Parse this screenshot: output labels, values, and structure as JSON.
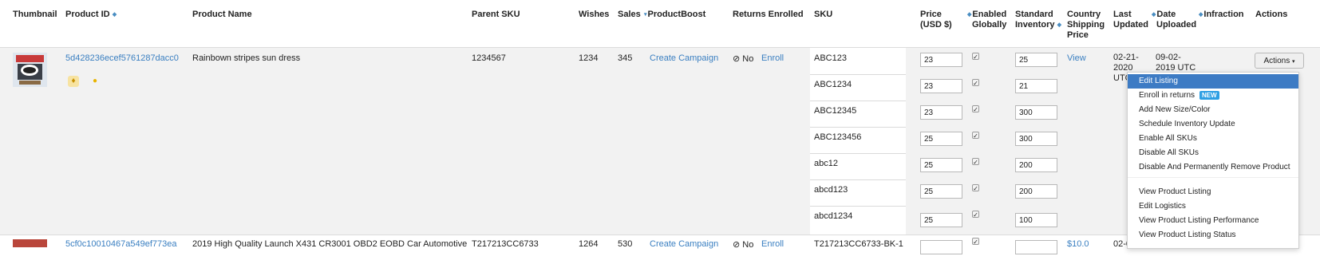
{
  "headers": {
    "thumbnail": "Thumbnail",
    "product_id": "Product ID",
    "product_name": "Product Name",
    "parent_sku": "Parent SKU",
    "wishes": "Wishes",
    "sales": "Sales",
    "product_boost": "ProductBoost",
    "returns_enrolled": "Returns Enrolled",
    "sku": "SKU",
    "price_l1": "Price",
    "price_l2": "(USD $)",
    "enabled_l1": "Enabled",
    "enabled_l2": "Globally",
    "inventory_l1": "Standard",
    "inventory_l2": "Inventory",
    "country_l1": "Country",
    "country_l2": "Shipping",
    "country_l3": "Price",
    "last_updated_l1": "Last",
    "last_updated_l2": "Updated",
    "date_uploaded_l1": "Date",
    "date_uploaded_l2": "Uploaded",
    "infraction": "Infraction",
    "actions": "Actions"
  },
  "row1": {
    "product_id": "5d428236ecef5761287dacc0",
    "product_name": "Rainbown stripes sun dress",
    "parent_sku": "1234567",
    "wishes": "1234",
    "sales": "345",
    "boost_link": "Create Campaign",
    "returns_status": "No",
    "returns_link": "Enroll",
    "country_link": "View",
    "last_updated_l1": "02-21-",
    "last_updated_l2": "2020",
    "last_updated_l3": "UTC",
    "date_uploaded_l1": "09-02-",
    "date_uploaded_l2": "2019 UTC",
    "actions_button": "Actions",
    "skus": [
      {
        "sku": "ABC123",
        "price": "23",
        "inventory": "25"
      },
      {
        "sku": "ABC1234",
        "price": "23",
        "inventory": "21"
      },
      {
        "sku": "ABC12345",
        "price": "23",
        "inventory": "300"
      },
      {
        "sku": "ABC123456",
        "price": "25",
        "inventory": "300"
      },
      {
        "sku": "abc12",
        "price": "25",
        "inventory": "200"
      },
      {
        "sku": "abcd123",
        "price": "25",
        "inventory": "200"
      },
      {
        "sku": "abcd1234",
        "price": "25",
        "inventory": "100"
      }
    ]
  },
  "row2": {
    "product_id": "5cf0c10010467a549ef773ea",
    "product_name": "2019 High Quality Launch X431 CR3001 OBD2 EOBD Car Automotive",
    "parent_sku": "T217213CC6733",
    "wishes": "1264",
    "sales": "530",
    "boost_link": "Create Campaign",
    "returns_status": "No",
    "returns_link": "Enroll",
    "sku": "T217213CC6733-BK-1",
    "country_link": "$10.0",
    "last_updated": "02-0"
  },
  "dropdown": {
    "items": [
      "Edit Listing",
      "Enroll in returns",
      "Add New Size/Color",
      "Schedule Inventory Update",
      "Enable All SKUs",
      "Disable All SKUs",
      "Disable And Permanently Remove Product",
      "View Product Listing",
      "Edit Logistics",
      "View Product Listing Performance",
      "View Product Listing Status"
    ],
    "new_badge": "NEW"
  },
  "colors": {
    "link": "#3a7fc1",
    "active_item": "#3d7bc4",
    "badge": "#2e9fe3"
  }
}
